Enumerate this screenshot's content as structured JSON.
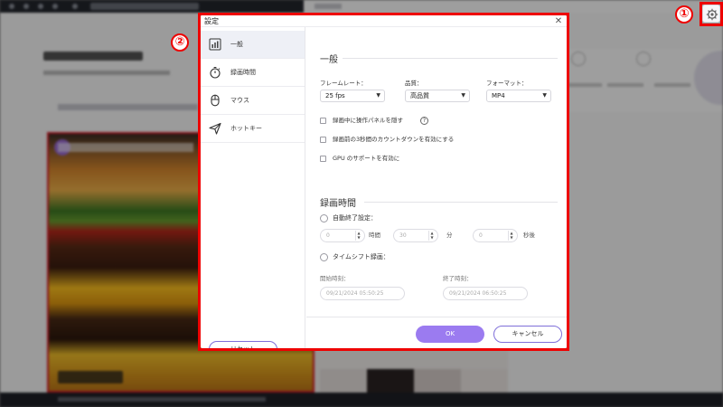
{
  "markers": {
    "one": "①",
    "two": "②"
  },
  "dialog": {
    "title": "設定",
    "close_glyph": "✕",
    "sidebar": {
      "items": [
        {
          "label": "一般",
          "icon": "chart-bars-icon"
        },
        {
          "label": "録画時間",
          "icon": "stopwatch-icon"
        },
        {
          "label": "マウス",
          "icon": "mouse-icon"
        },
        {
          "label": "ホットキー",
          "icon": "send-arrow-icon"
        }
      ],
      "reset_label": "リセット"
    },
    "general": {
      "section_title": "一般",
      "framerate": {
        "label": "フレームレート：",
        "value": "25 fps"
      },
      "quality": {
        "label": "品質：",
        "value": "高品質"
      },
      "format": {
        "label": "フォーマット：",
        "value": "MP4"
      },
      "options": [
        "録画中に操作パネルを隠す",
        "録画前の3秒間のカウントダウンを有効にする",
        "GPU のサポートを有効に"
      ],
      "help_glyph": "?"
    },
    "recording_time": {
      "section_title": "録画時間",
      "auto_end_label": "自動終了設定：",
      "hours_value": "0",
      "hours_unit": "時間",
      "minutes_value": "30",
      "minutes_unit": "分",
      "seconds_value": "0",
      "seconds_unit": "秒後",
      "timeshift_label": "タイムシフト録画：",
      "start_label": "開始時刻：",
      "start_value": "09/21/2024 05:50:25",
      "end_label": "終了時刻：",
      "end_value": "09/21/2024 06:50:25"
    },
    "ok_label": "OK",
    "cancel_label": "キャンセル"
  },
  "colors": {
    "accent": "#9b7bf0",
    "highlight": "#e00000"
  }
}
